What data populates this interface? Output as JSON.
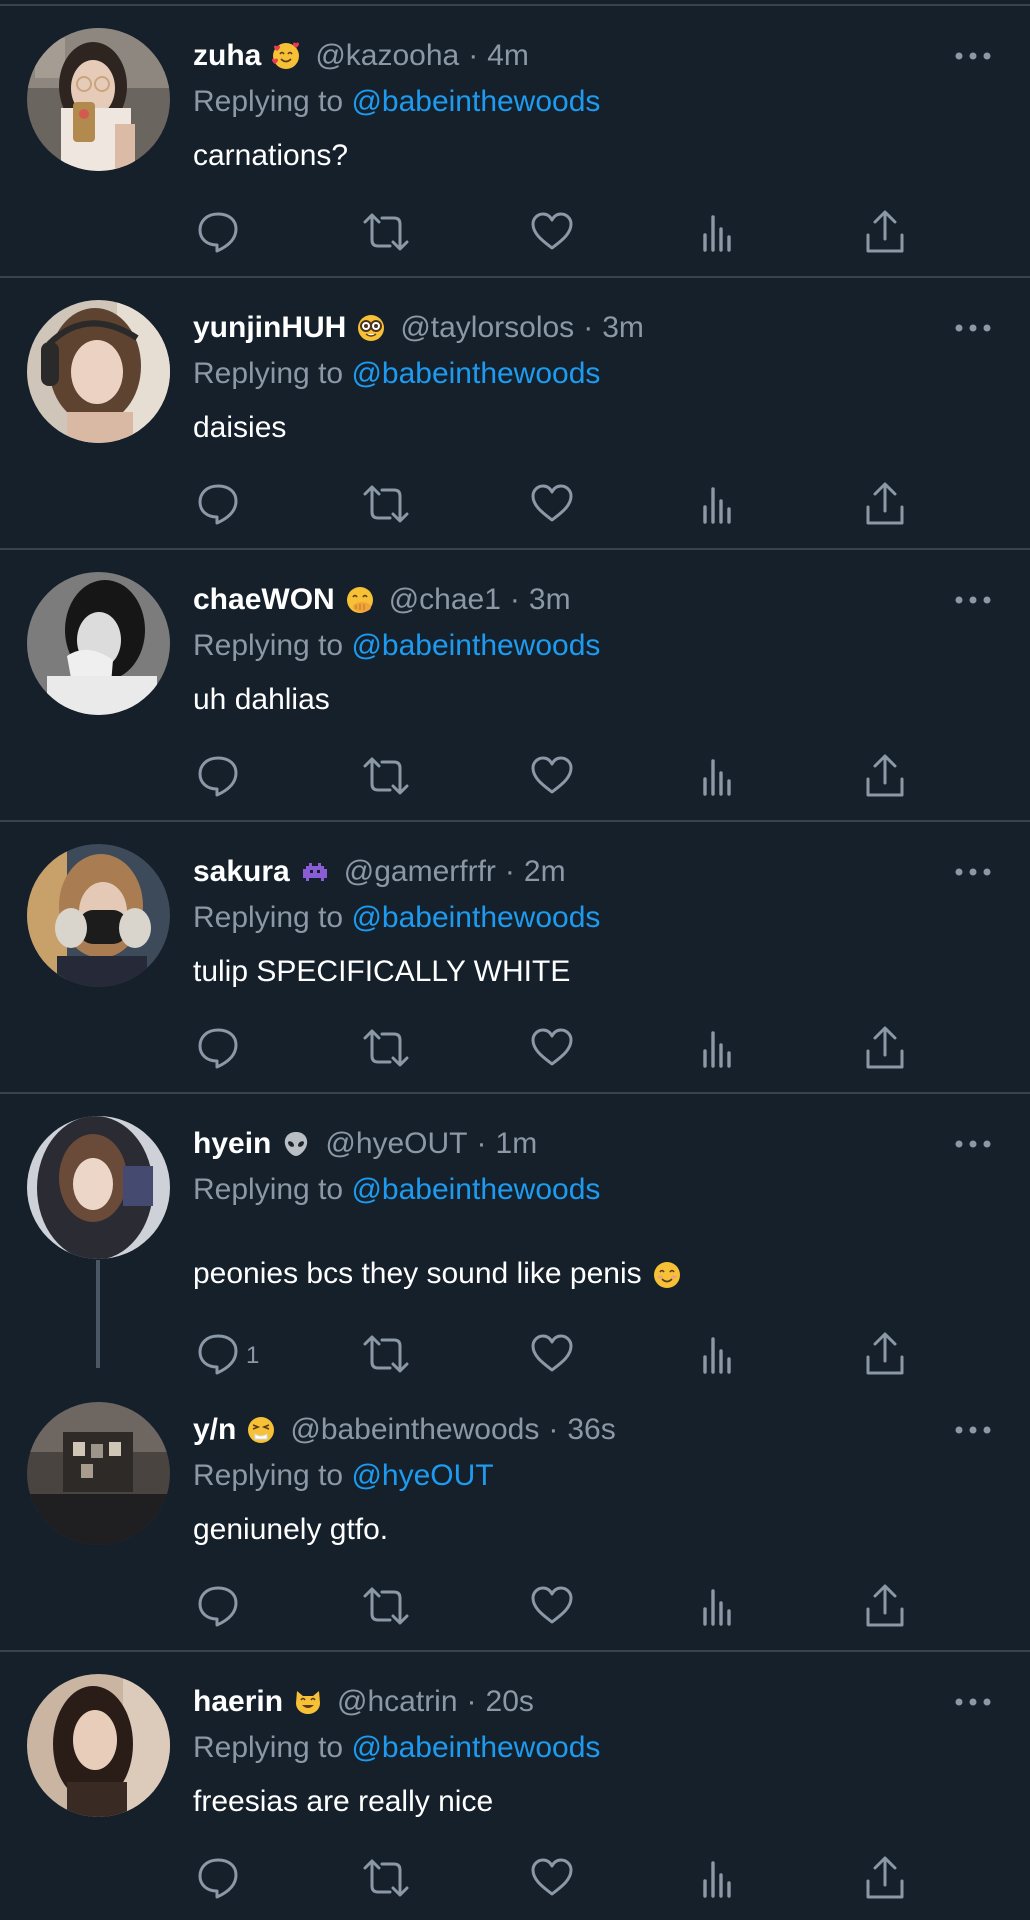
{
  "reply_prefix": "Replying to",
  "dot": "·",
  "colors": {
    "background": "#15202b",
    "divider": "#38444d",
    "text": "#ffffff",
    "muted": "#8b98a5",
    "link": "#1d9bf0"
  },
  "icons": {
    "reply": "comment-bubble-icon",
    "retweet": "retweet-icon",
    "like": "heart-icon",
    "views": "bar-chart-icon",
    "share": "share-icon",
    "more": "more-dots-icon"
  },
  "tweets": [
    {
      "name": "zuha",
      "emoji": "smiling-face-with-hearts-emoji",
      "handle": "@kazooha",
      "time": "4m",
      "replying_to": "@babeinthewoods",
      "text": "carnations?",
      "reply_count": ""
    },
    {
      "name": "yunjinHUH",
      "emoji": "nerd-face-emoji",
      "handle": "@taylorsolos",
      "time": "3m",
      "replying_to": "@babeinthewoods",
      "text": "daisies",
      "reply_count": ""
    },
    {
      "name": "chaeWON",
      "emoji": "face-with-hand-over-mouth-emoji",
      "handle": "@chae1",
      "time": "3m",
      "replying_to": "@babeinthewoods",
      "text": "uh dahlias",
      "reply_count": ""
    },
    {
      "name": "sakura",
      "emoji": "alien-monster-emoji",
      "handle": "@gamerfrfr",
      "time": "2m",
      "replying_to": "@babeinthewoods",
      "text": "tulip SPECIFICALLY WHITE",
      "reply_count": ""
    },
    {
      "name": "hyein",
      "emoji": "alien-emoji",
      "handle": "@hyeOUT",
      "time": "1m",
      "replying_to": "@babeinthewoods",
      "text": "peonies bcs they sound like penis",
      "text_emoji": "smiling-face-emoji",
      "reply_count": "1"
    },
    {
      "name": "y/n",
      "emoji": "sneezing-face-emoji",
      "handle": "@babeinthewoods",
      "time": "36s",
      "replying_to": "@hyeOUT",
      "text": "geniunely gtfo.",
      "reply_count": ""
    },
    {
      "name": "haerin",
      "emoji": "grinning-cat-emoji",
      "handle": "@hcatrin",
      "time": "20s",
      "replying_to": "@babeinthewoods",
      "text": "freesias are really nice",
      "reply_count": ""
    }
  ]
}
